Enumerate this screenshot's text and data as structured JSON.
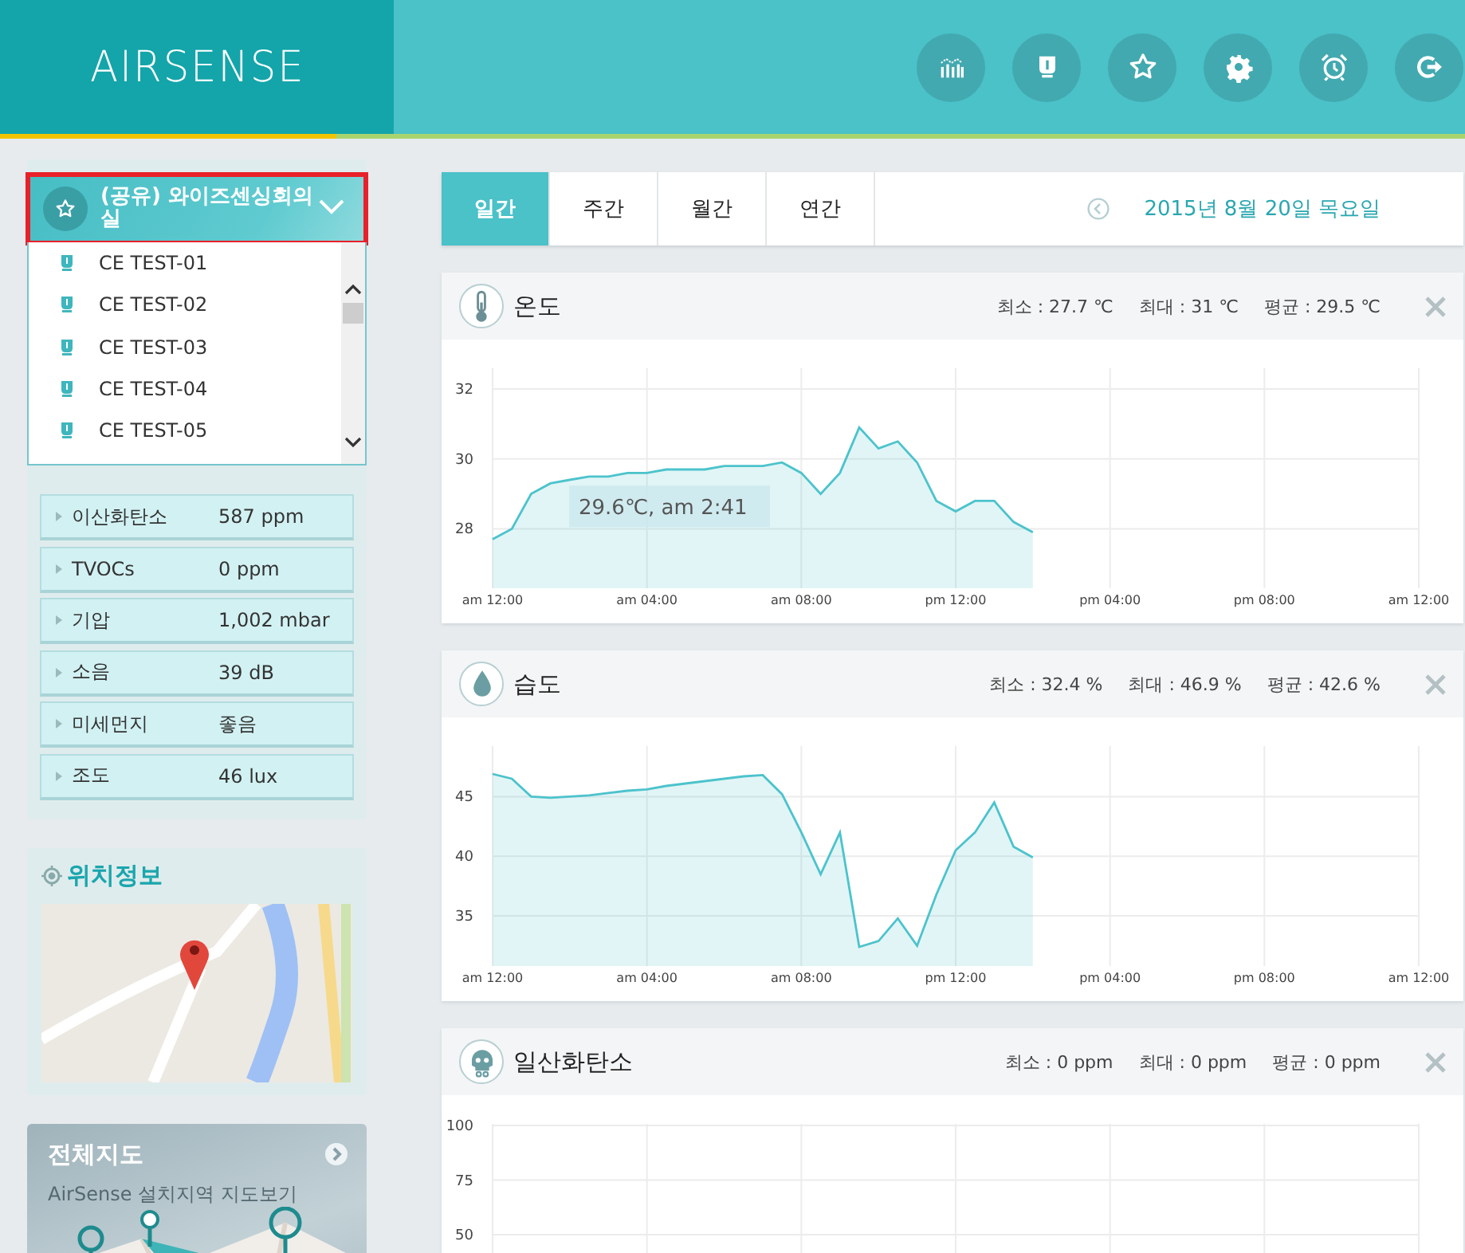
{
  "header": {
    "logo": "AIRSENSE"
  },
  "sidebar": {
    "device_select": {
      "label": "(공유) 와이즈센싱회의실",
      "expanded": true,
      "highlighted": true,
      "items": [
        {
          "label": "CE TEST-01",
          "selected": false
        },
        {
          "label": "CE TEST-02",
          "selected": false
        },
        {
          "label": "CE TEST-03",
          "selected": false
        },
        {
          "label": "CE TEST-04",
          "selected": false
        },
        {
          "label": "CE TEST-05",
          "selected": false
        }
      ]
    },
    "sensors": [
      {
        "name": "이산화탄소",
        "value": "587 ppm"
      },
      {
        "name": "TVOCs",
        "value": "0 ppm"
      },
      {
        "name": "기압",
        "value": "1,002 mbar"
      },
      {
        "name": "소음",
        "value": "39 dB"
      },
      {
        "name": "미세먼지",
        "value": "좋음"
      },
      {
        "name": "조도",
        "value": "46 lux"
      }
    ],
    "location": {
      "title": "위치정보"
    },
    "full_map": {
      "title": "전체지도",
      "subtitle": "AirSense 설치지역 지도보기"
    }
  },
  "period_tabs": [
    {
      "label": "일간",
      "selected": true
    },
    {
      "label": "주간",
      "selected": false
    },
    {
      "label": "월간",
      "selected": false
    },
    {
      "label": "연간",
      "selected": false
    }
  ],
  "date": "2015년 8월 20일 목요일",
  "panels": [
    {
      "kind": "temperature",
      "title": "온도",
      "stats": [
        "최소 : 27.7 ℃",
        "최대 : 31 ℃",
        "평균 : 29.5 ℃"
      ],
      "chart_data": {
        "type": "area",
        "ylim": [
          26.3,
          32.55
        ],
        "yticks": [
          28,
          30,
          32
        ],
        "categories": [
          "am 12:00",
          null,
          null,
          null,
          null,
          null,
          null,
          null,
          "am 04:00",
          null,
          null,
          null,
          null,
          null,
          null,
          null,
          "am 08:00",
          null,
          null,
          null,
          null,
          null,
          null,
          null,
          "pm 12:00",
          null,
          null,
          null,
          null,
          null,
          null,
          null,
          "pm 04:00",
          null,
          null,
          null,
          null,
          null,
          null,
          null,
          "pm 08:00",
          null,
          null,
          null,
          null,
          null,
          null,
          null,
          "am 12:00"
        ],
        "series": [
          {
            "color": "#4cc3cc",
            "values": [
              27.7,
              28.0,
              29.0,
              29.3,
              29.4,
              29.5,
              29.5,
              29.6,
              29.6,
              29.7,
              29.7,
              29.7,
              29.8,
              29.8,
              29.8,
              29.9,
              29.6,
              29.0,
              29.6,
              30.9,
              30.3,
              30.5,
              29.9,
              28.8,
              28.5,
              28.8,
              28.8,
              28.2,
              27.9,
              null,
              null,
              null,
              null,
              null,
              null,
              null,
              null,
              null,
              null,
              null,
              null,
              null,
              null,
              null,
              null,
              null,
              null,
              null,
              null
            ]
          }
        ],
        "grid": true,
        "annotations": [
          {
            "text": "29.6℃, am 2:41",
            "y": 29.6
          }
        ]
      }
    },
    {
      "kind": "humidity",
      "title": "습도",
      "stats": [
        "최소 : 32.4 %",
        "최대 : 46.9 %",
        "평균 : 42.6 %"
      ],
      "chart_data": {
        "type": "area",
        "grid": true,
        "ylim": [
          30.8,
          49.1
        ],
        "yticks": [
          35,
          40,
          45
        ],
        "categories": [
          "am 12:00",
          null,
          null,
          null,
          null,
          null,
          null,
          null,
          "am 04:00",
          null,
          null,
          null,
          null,
          null,
          null,
          null,
          "am 08:00",
          null,
          null,
          null,
          null,
          null,
          null,
          null,
          "pm 12:00",
          null,
          null,
          null,
          null,
          null,
          null,
          null,
          "pm 04:00",
          null,
          null,
          null,
          null,
          null,
          null,
          null,
          "pm 08:00",
          null,
          null,
          null,
          null,
          null,
          null,
          null,
          "am 12:00"
        ],
        "series": [
          {
            "color": "#4cc3cc",
            "values": [
              46.9,
              46.5,
              45.0,
              44.9,
              45.0,
              45.1,
              45.3,
              45.5,
              45.6,
              45.9,
              46.1,
              46.3,
              46.5,
              46.7,
              46.8,
              45.2,
              42.0,
              38.5,
              42.0,
              32.4,
              32.9,
              34.8,
              32.5,
              36.8,
              40.5,
              42.0,
              44.5,
              40.8,
              39.9,
              null,
              null,
              null,
              null,
              null,
              null,
              null,
              null,
              null,
              null,
              null,
              null,
              null,
              null,
              null,
              null,
              null,
              null,
              null,
              null
            ]
          }
        ]
      }
    },
    {
      "kind": "carbon_monoxide",
      "title": "일산화탄소",
      "stats": [
        "최소 : 0 ppm",
        "최대 : 0 ppm",
        "평균 : 0 ppm"
      ],
      "chart_data": {
        "type": "area",
        "grid": true,
        "ylim": [
          0,
          100
        ],
        "yticks": [
          50,
          75,
          100
        ],
        "categories": [
          null,
          null,
          null,
          null,
          null,
          null,
          null
        ]
      }
    }
  ]
}
